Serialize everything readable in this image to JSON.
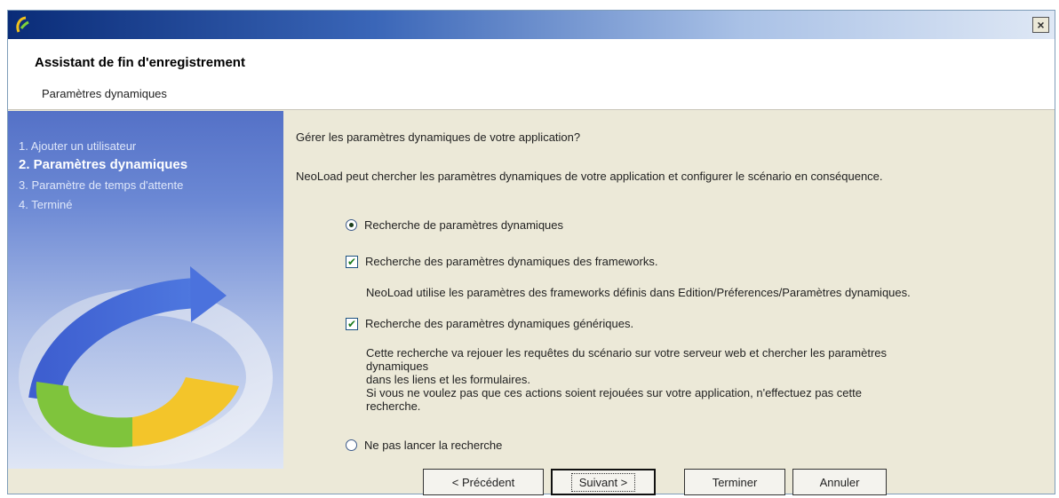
{
  "window": {
    "title": "",
    "close_symbol": "×"
  },
  "header": {
    "title": "Assistant de fin d'enregistrement",
    "subtitle": "Paramètres dynamiques"
  },
  "sidebar": {
    "steps": [
      {
        "label": "1. Ajouter un utilisateur",
        "active": false
      },
      {
        "label": "2. Paramètres dynamiques",
        "active": true
      },
      {
        "label": "3. Paramètre de temps d'attente",
        "active": false
      },
      {
        "label": "4. Terminé",
        "active": false
      }
    ],
    "graphic": "circular-arrow-icon"
  },
  "content": {
    "question": "Gérer les paramètres dynamiques de votre application?",
    "intro": "NeoLoad peut chercher les paramètres dynamiques de votre application et configurer le scénario en conséquence.",
    "radio_search": {
      "label": "Recherche de paramètres dynamiques",
      "selected": true
    },
    "check_frameworks": {
      "label": "Recherche des paramètres dynamiques des frameworks.",
      "checked": true
    },
    "frameworks_desc": "NeoLoad utilise les paramètres des frameworks définis dans Edition/Préferences/Paramètres dynamiques.",
    "check_generic": {
      "label": "Recherche des paramètres dynamiques génériques.",
      "checked": true
    },
    "generic_desc": [
      "Cette recherche va rejouer les requêtes du scénario sur votre serveur web et chercher les paramètres",
      "dynamiques",
      "dans les liens et les formulaires.",
      "Si vous ne voulez pas que ces actions soient rejouées sur votre application, n'effectuez pas cette",
      "recherche."
    ],
    "radio_none": {
      "label": "Ne pas lancer la recherche",
      "selected": false
    }
  },
  "footer": {
    "prev_label": "< Précédent",
    "next_label": "Suivant >",
    "finish_label": "Terminer",
    "cancel_label": "Annuler"
  }
}
